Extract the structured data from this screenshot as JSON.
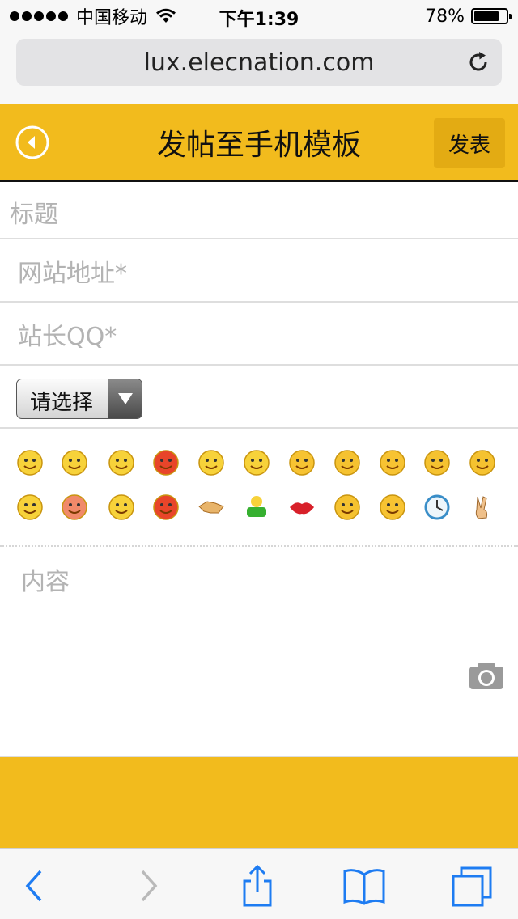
{
  "status_bar": {
    "carrier": "中国移动",
    "time": "下午1:39",
    "battery_percent": "78%",
    "battery_level": 0.78,
    "signal_dots": 5
  },
  "browser": {
    "url": "lux.elecnation.com"
  },
  "header": {
    "title": "发帖至手机模板",
    "publish_label": "发表",
    "accent_color": "#f2bb1d"
  },
  "form": {
    "title_placeholder": "标题",
    "site_placeholder": "网站地址*",
    "qq_placeholder": "站长QQ*",
    "select_value": "请选择",
    "content_placeholder": "内容"
  },
  "emoticons": [
    [
      "smile-emoticon",
      "frown-emoticon",
      "grin-emoticon",
      "angry-emoticon",
      "surprised-emoticon",
      "tongue-emoticon",
      "blush-emoticon",
      "shy-emoticon",
      "sweat-emoticon",
      "cry-emoticon",
      "laugh-emoticon"
    ],
    [
      "happy-emoticon",
      "mad-emoticon",
      "sick-emoticon",
      "annoyed-emoticon",
      "handshake-emoticon",
      "hug-emoticon",
      "lips-emoticon",
      "silent-emoticon",
      "sleepy-emoticon",
      "clock-emoticon",
      "victory-emoticon"
    ]
  ],
  "icons": {
    "back": "circle-left-arrow-icon",
    "reload": "reload-icon",
    "camera": "camera-icon",
    "nav_back": "chevron-left-icon",
    "nav_forward": "chevron-right-icon",
    "share": "share-icon",
    "bookmarks": "bookmarks-icon",
    "tabs": "tabs-icon"
  }
}
